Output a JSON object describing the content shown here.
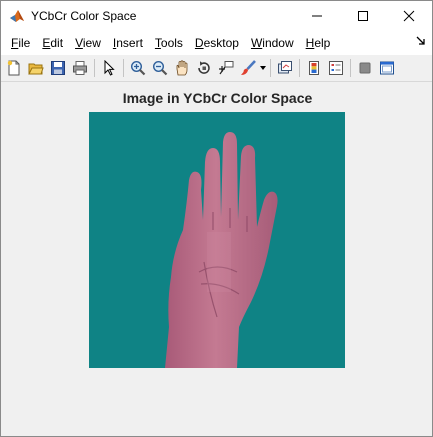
{
  "window": {
    "title": "YCbCr Color Space",
    "controls": [
      "minimize-icon",
      "maximize-icon",
      "close-icon"
    ]
  },
  "menu": {
    "items": [
      {
        "mnemonic": "F",
        "rest": "ile"
      },
      {
        "mnemonic": "E",
        "rest": "dit"
      },
      {
        "mnemonic": "V",
        "rest": "iew"
      },
      {
        "mnemonic": "I",
        "rest": "nsert"
      },
      {
        "mnemonic": "T",
        "rest": "ools"
      },
      {
        "mnemonic": "D",
        "rest": "esktop"
      },
      {
        "mnemonic": "W",
        "rest": "indow"
      },
      {
        "mnemonic": "H",
        "rest": "elp"
      }
    ]
  },
  "toolbar": {
    "icons": [
      "new-figure-icon",
      "open-file-icon",
      "save-icon",
      "print-icon",
      "pointer-icon",
      "zoom-in-icon",
      "zoom-out-icon",
      "pan-icon",
      "rotate-3d-icon",
      "data-cursor-icon",
      "brush-icon",
      "link-plot-icon",
      "colorbar-icon",
      "legend-icon",
      "hide-plot-tools-icon",
      "show-plot-tools-icon"
    ]
  },
  "figure": {
    "title": "Image in YCbCr Color Space",
    "colors": {
      "background": "#0f8385",
      "hand": "#c07088"
    }
  }
}
